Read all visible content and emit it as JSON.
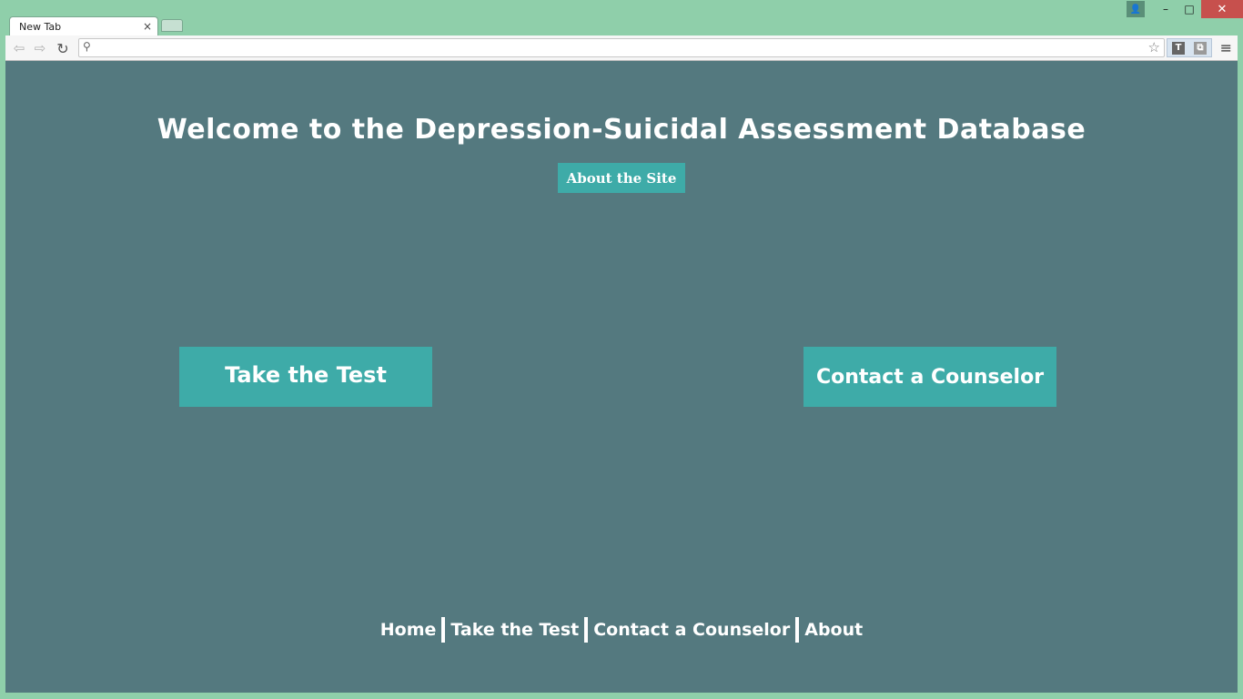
{
  "browser": {
    "tab_title": "New Tab",
    "tab_close": "×",
    "address_value": "",
    "nav_back": "⇦",
    "nav_forward": "⇨",
    "nav_reload": "↻",
    "search_glyph": "⚲",
    "star_glyph": "☆",
    "ext1": "T",
    "ext2": "⧉",
    "menu_glyph": "≡",
    "win_profile": "👤",
    "win_minimize": "–",
    "win_maximize": "□",
    "win_close": "✕"
  },
  "page": {
    "title": "Welcome to the Depression-Suicidal Assessment Database",
    "about_button": "About the Site",
    "take_test_button": "Take the Test",
    "contact_button": "Contact a Counselor",
    "footer": {
      "home": "Home",
      "take_test": "Take the Test",
      "contact": "Contact a Counselor",
      "about": "About"
    }
  },
  "colors": {
    "window_frame": "#8fcfaa",
    "page_background": "#54797f",
    "button_accent": "#3eaba8",
    "close_button": "#c7504d"
  }
}
